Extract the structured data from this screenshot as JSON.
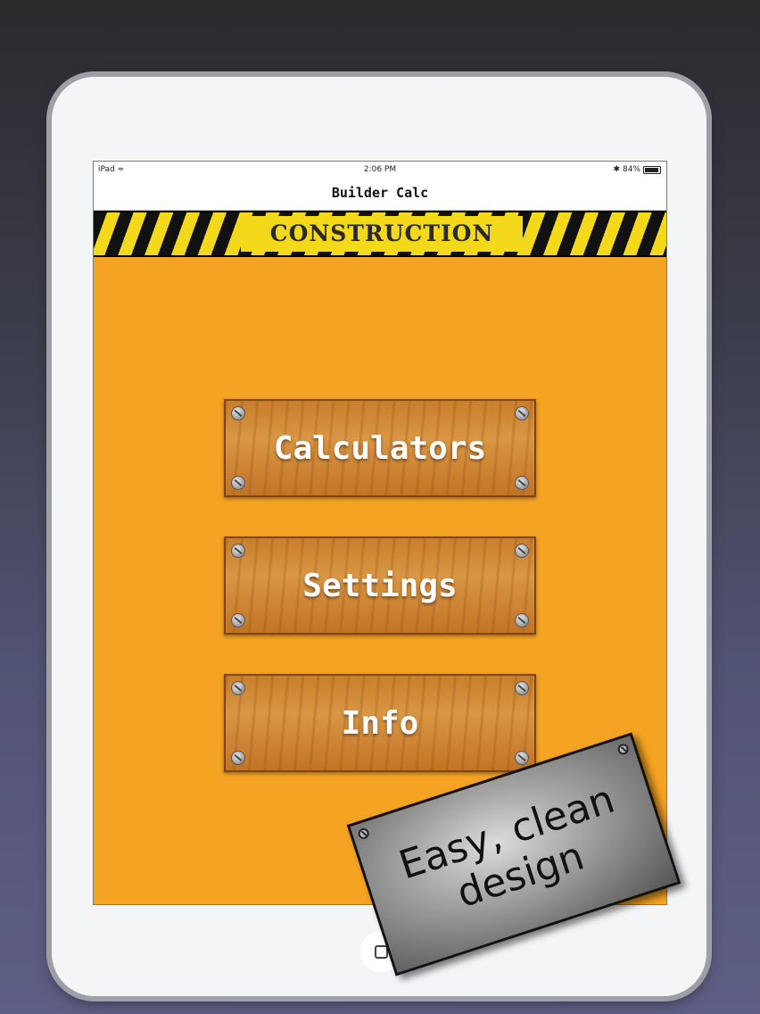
{
  "status_bar": {
    "device": "iPad",
    "time": "2:06 PM",
    "battery": "84%"
  },
  "nav": {
    "title": "Builder Calc"
  },
  "banner": {
    "label": "CONSTRUCTION"
  },
  "menu": [
    {
      "label": "Calculators"
    },
    {
      "label": "Settings"
    },
    {
      "label": "Info"
    }
  ],
  "promo": {
    "line1": "Easy, clean",
    "line2": "design"
  },
  "colors": {
    "background": "#f5a322",
    "stripe": "#f4d81a",
    "wood": "#c97e2a"
  }
}
